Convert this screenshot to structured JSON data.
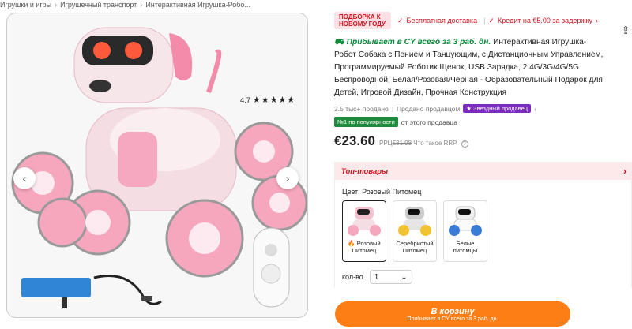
{
  "breadcrumb": [
    "Игрушки и игры",
    "Игрушечный транспорт",
    "Интерактивная Игрушка-Робо..."
  ],
  "promo": {
    "tag": "Подборка к Новому году",
    "free_delivery": "Бесплатная доставка",
    "credit": "Кредит на €5.00 за задержку"
  },
  "product": {
    "arrival": "Прибывает в CY всего за 3 раб. дн.",
    "title": "Интерактивная Игрушка-Робот Собака с Пением и Танцующим, с Дистанционным Управлением, Программируемый Роботик Щенок, USB Зарядка, 2.4G/3G/4G/5G Беспроводной, Белая/Розовая/Черная - Образовательный Подарок для Детей, Игровой Дизайн, Прочная Конструкция",
    "sold": "2.5 тыс+ продано",
    "seller_label": "Продано продавцом",
    "star_seller": "Звездный продавец",
    "rating": "4.7",
    "stars": "★★★★★",
    "rank_badge": "№1 по популярности",
    "rank_text": "от этого продавца",
    "price": "€23.60",
    "rrp": "€31.98",
    "rrp_prefix": "РРЦ",
    "rrp_suffix": "Что такое RRP"
  },
  "top_goods": "Топ-товары",
  "color": {
    "label": "Цвет: Розовый Питомец",
    "options": [
      "Розовый Питомец",
      "Серебристый Питомец",
      "Белые питомцы"
    ],
    "selected_index": 0
  },
  "qty": {
    "label": "кол-во",
    "value": "1"
  },
  "cart": {
    "label": "В корзину",
    "sub": "Прибывает в CY всего за 3 раб. дн."
  },
  "colors": {
    "accent": "#fd7e14",
    "promo_red": "#d3111e",
    "green": "#0a8a3a",
    "star_purple": "#7b2cbf"
  },
  "icons": {
    "prev": "chevron-left-icon",
    "next": "chevron-right-icon",
    "share": "share-icon"
  }
}
